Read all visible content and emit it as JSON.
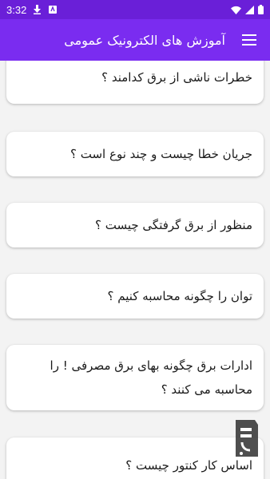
{
  "status_bar": {
    "time": "3:32",
    "icons": [
      "download-icon",
      "store-icon",
      "wifi-icon",
      "signal-icon",
      "battery-icon"
    ]
  },
  "app_bar": {
    "title": "آموزش های الکترونیک عمومی",
    "menu_icon": "hamburger-menu-icon"
  },
  "questions": [
    "خطرات ناشی از برق کدامند ؟",
    "جریان خطا چیست و چند نوع است ؟",
    "منظور از برق گرفتگی چیست ؟",
    "توان را چگونه محاسبه کنیم ؟",
    "ادارات برق چگونه بهای برق مصرفی ! را محاسبه می کنند ؟",
    "اساس کار کنتور چیست ؟"
  ],
  "colors": {
    "status_bar": "#6a1fd8",
    "app_bar": "#7a2cf0",
    "background": "#f3f3f3",
    "card": "#ffffff"
  }
}
